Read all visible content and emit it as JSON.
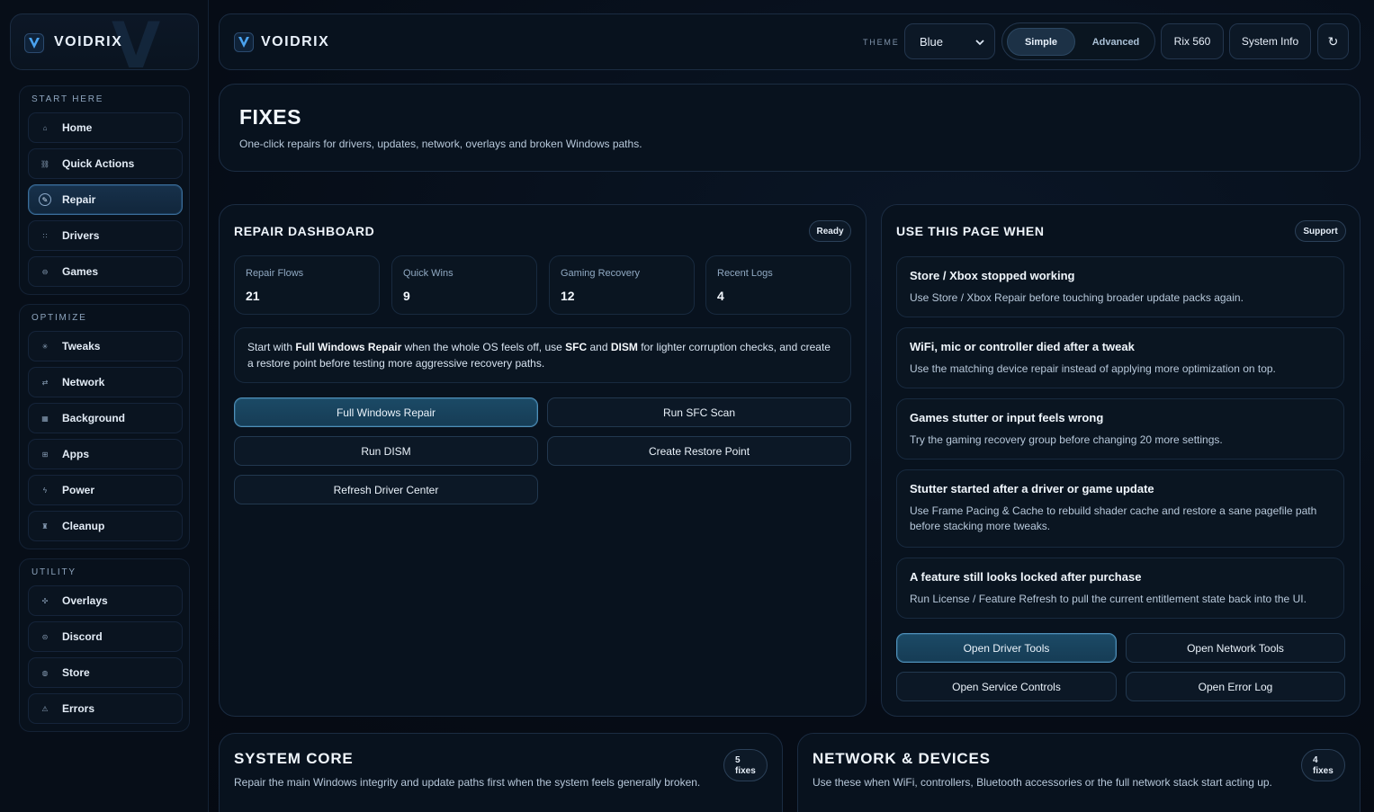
{
  "brand": {
    "name": "VOIDRIX",
    "watermark": "V"
  },
  "sidebar": {
    "groups": [
      {
        "title": "START HERE",
        "items": [
          {
            "label": "Home",
            "icon": "⌂"
          },
          {
            "label": "Quick Actions",
            "icon": "⛓"
          },
          {
            "label": "Repair",
            "icon": "✎",
            "active": true
          },
          {
            "label": "Drivers",
            "icon": "∷"
          },
          {
            "label": "Games",
            "icon": "⊖"
          }
        ]
      },
      {
        "title": "OPTIMIZE",
        "items": [
          {
            "label": "Tweaks",
            "icon": "✳"
          },
          {
            "label": "Network",
            "icon": "⇄"
          },
          {
            "label": "Background",
            "icon": "▦"
          },
          {
            "label": "Apps",
            "icon": "⊞"
          },
          {
            "label": "Power",
            "icon": "ϟ"
          },
          {
            "label": "Cleanup",
            "icon": "♜"
          }
        ]
      },
      {
        "title": "UTILITY",
        "items": [
          {
            "label": "Overlays",
            "icon": "✣"
          },
          {
            "label": "Discord",
            "icon": "⊝"
          },
          {
            "label": "Store",
            "icon": "◍"
          },
          {
            "label": "Errors",
            "icon": "⚠"
          }
        ]
      }
    ]
  },
  "topbar": {
    "theme_label": "THEME",
    "theme_value": "Blue",
    "mode_simple": "Simple",
    "mode_advanced": "Advanced",
    "rix": "Rix 560",
    "system_info": "System Info",
    "refresh_icon": "↻"
  },
  "header": {
    "title": "FIXES",
    "subtitle": "One-click repairs for drivers, updates, network, overlays and broken Windows paths."
  },
  "dashboard": {
    "title": "REPAIR DASHBOARD",
    "status": "Ready",
    "stats": [
      {
        "label": "Repair Flows",
        "value": "21"
      },
      {
        "label": "Quick Wins",
        "value": "9"
      },
      {
        "label": "Gaming Recovery",
        "value": "12"
      },
      {
        "label": "Recent Logs",
        "value": "4"
      }
    ],
    "note": {
      "t1": "Start with ",
      "b1": "Full Windows Repair",
      "t2": " when the whole OS feels off, use ",
      "b2": "SFC",
      "t3": " and ",
      "b3": "DISM",
      "t4": " for lighter corruption checks, and create a restore point before testing more aggressive recovery paths."
    },
    "buttons": [
      "Full Windows Repair",
      "Run SFC Scan",
      "Run DISM",
      "Create Restore Point",
      "Refresh Driver Center"
    ]
  },
  "when": {
    "title": "USE THIS PAGE WHEN",
    "badge": "Support",
    "items": [
      {
        "title": "Store / Xbox stopped working",
        "desc": "Use Store / Xbox Repair before touching broader update packs again."
      },
      {
        "title": "WiFi, mic or controller died after a tweak",
        "desc": "Use the matching device repair instead of applying more optimization on top."
      },
      {
        "title": "Games stutter or input feels wrong",
        "desc": "Try the gaming recovery group before changing 20 more settings."
      },
      {
        "title": "Stutter started after a driver or game update",
        "desc": "Use Frame Pacing & Cache to rebuild shader cache and restore a sane pagefile path before stacking more tweaks."
      },
      {
        "title": "A feature still looks locked after purchase",
        "desc": "Run License / Feature Refresh to pull the current entitlement state back into the UI."
      }
    ],
    "buttons": [
      "Open Driver Tools",
      "Open Network Tools",
      "Open Service Controls",
      "Open Error Log"
    ]
  },
  "sections": [
    {
      "title": "SYSTEM CORE",
      "desc": "Repair the main Windows integrity and update paths first when the system feels generally broken.",
      "count": "5",
      "count_label": "fixes"
    },
    {
      "title": "NETWORK & DEVICES",
      "desc": "Use these when WiFi, controllers, Bluetooth accessories or the full network stack start acting up.",
      "count": "4",
      "count_label": "fixes"
    }
  ],
  "colors": {
    "accent": "#4f8fb8",
    "background": "#050b14",
    "panel": "#08121e",
    "logo": "#3d8fe0"
  }
}
